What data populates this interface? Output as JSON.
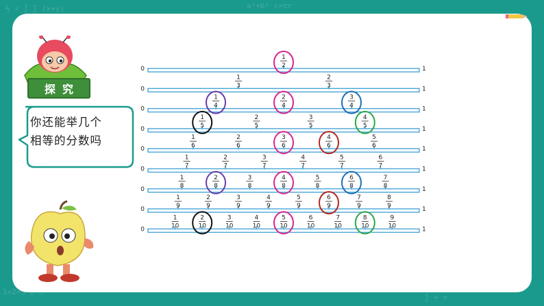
{
  "tag": {
    "left": "探",
    "right": "究"
  },
  "speech": {
    "line1": "你还能举几个",
    "line2": "相等的分数吗"
  },
  "fraction_lines": [
    {
      "d": 2,
      "zero": "0",
      "one": "1"
    },
    {
      "d": 3,
      "zero": "0",
      "one": "1"
    },
    {
      "d": 4,
      "zero": "0",
      "one": "1"
    },
    {
      "d": 5,
      "zero": "0",
      "one": "1"
    },
    {
      "d": 6,
      "zero": "0",
      "one": "1"
    },
    {
      "d": 7,
      "zero": "0",
      "one": "1"
    },
    {
      "d": 8,
      "zero": "0",
      "one": "1"
    },
    {
      "d": 9,
      "zero": "0",
      "one": "1"
    },
    {
      "d": 10,
      "zero": "0",
      "one": "1"
    }
  ],
  "circled": [
    {
      "n": 1,
      "d": 2,
      "color": "#d6268f"
    },
    {
      "n": 2,
      "d": 4,
      "color": "#d6268f"
    },
    {
      "n": 3,
      "d": 6,
      "color": "#d6268f"
    },
    {
      "n": 4,
      "d": 8,
      "color": "#d6268f"
    },
    {
      "n": 5,
      "d": 10,
      "color": "#d6268f"
    },
    {
      "n": 1,
      "d": 4,
      "color": "#6a3aa8"
    },
    {
      "n": 2,
      "d": 8,
      "color": "#6a3aa8"
    },
    {
      "n": 3,
      "d": 4,
      "color": "#1f6fb5"
    },
    {
      "n": 6,
      "d": 8,
      "color": "#1f6fb5"
    },
    {
      "n": 1,
      "d": 5,
      "color": "#111111"
    },
    {
      "n": 2,
      "d": 10,
      "color": "#111111"
    },
    {
      "n": 4,
      "d": 5,
      "color": "#2aa84a"
    },
    {
      "n": 8,
      "d": 10,
      "color": "#2aa84a"
    },
    {
      "n": 4,
      "d": 6,
      "color": "#b3261e"
    },
    {
      "n": 6,
      "d": 9,
      "color": "#b3261e"
    }
  ],
  "colors": {
    "background": "#1a9a8c",
    "line": "#4aa6d6",
    "tick": "#4aa6d6"
  }
}
